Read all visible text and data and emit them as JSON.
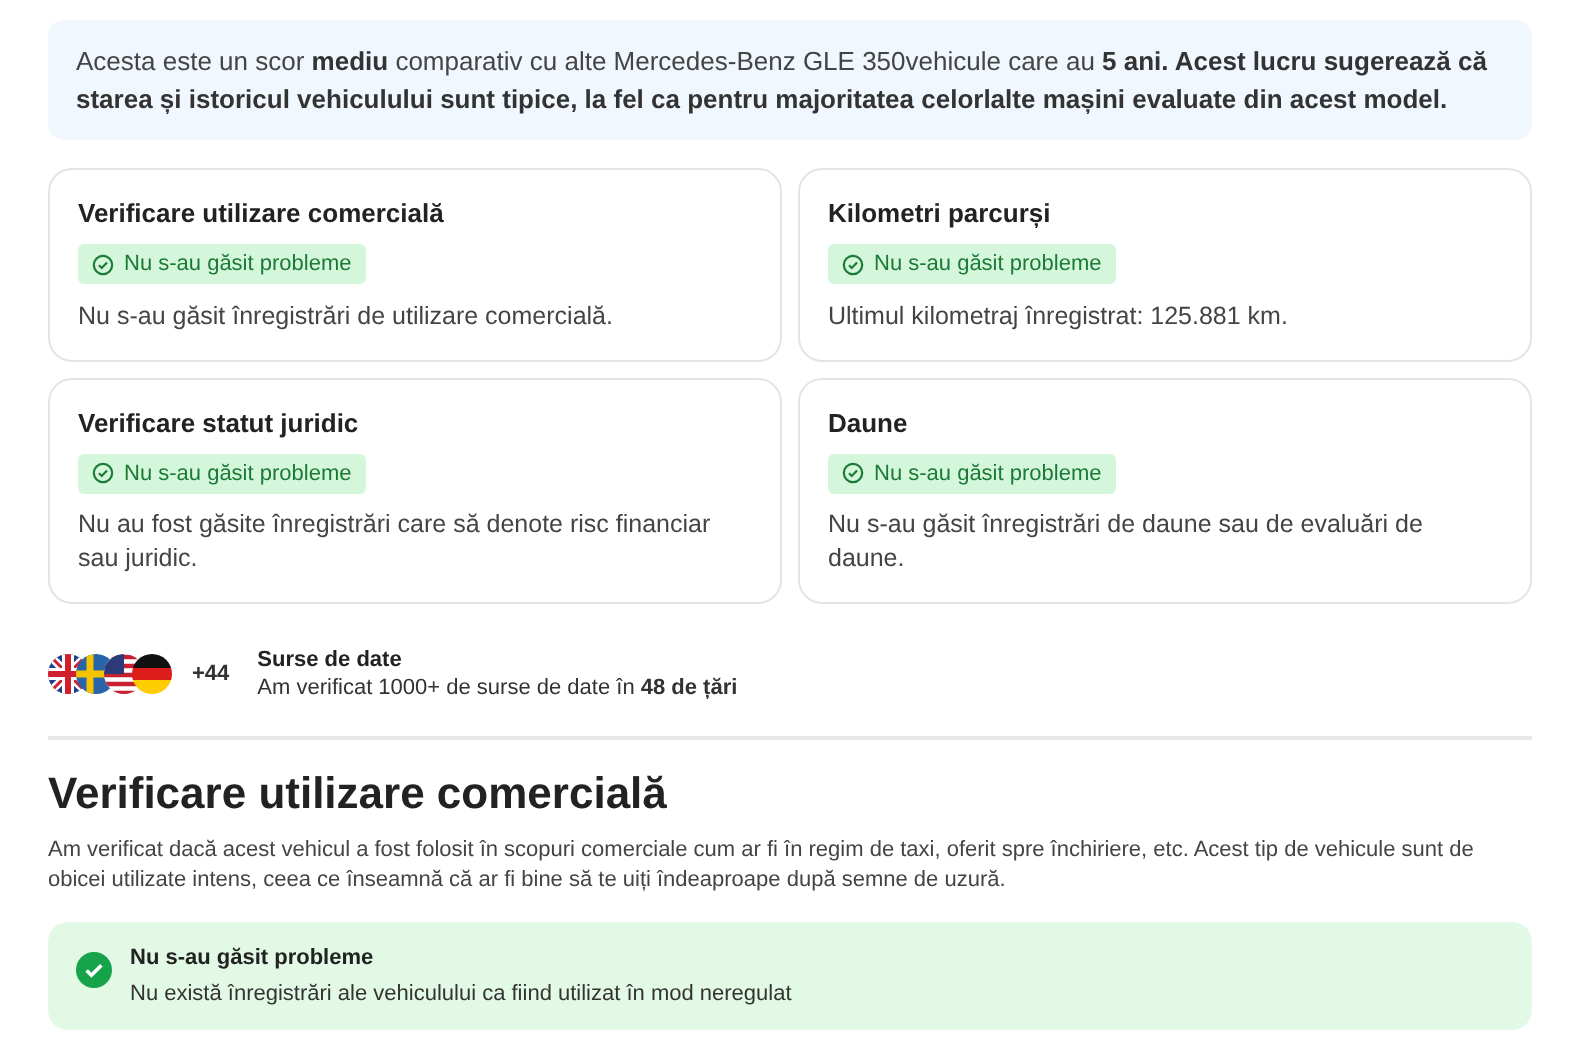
{
  "summary": {
    "text": "Acesta este un scor **mediu** comparativ cu alte Mercedes-Benz GLE 350vehicule care au **5 ani. Acest lucru sugerează că starea și istoricul vehiculului sunt tipice, la fel ca pentru majoritatea celorlalte mașini evaluate din acest model.**"
  },
  "cards": [
    {
      "title": "Verificare utilizare comercială",
      "badge": {
        "kind": "ok",
        "label": "Nu s-au găsit probleme"
      },
      "description": "Nu s-au găsit înregistrări de utilizare comercială."
    },
    {
      "title": "Kilometri parcurși",
      "badge": {
        "kind": "ok",
        "label": "Nu s-au găsit probleme"
      },
      "description": "Ultimul kilometraj înregistrat: 125.881 km."
    },
    {
      "title": "Verificare statut juridic",
      "badge": {
        "kind": "ok",
        "label": "Nu s-au găsit probleme"
      },
      "description": "Nu au fost găsite înregistrări care să denote risc financiar sau juridic."
    },
    {
      "title": "Daune",
      "badge": {
        "kind": "ok",
        "label": "Nu s-au găsit probleme"
      },
      "description": "Nu s-au găsit înregistrări de daune sau de evaluări de daune."
    }
  ],
  "sources": {
    "more_count": "+44",
    "title": "Surse de date",
    "text": "Am verificat 1000+ de surse de date în **48 de țări**"
  },
  "section": {
    "heading": "Verificare utilizare comercială",
    "text": "Am verificat dacă acest vehicul a fost folosit în scopuri comerciale cum ar fi în regim de taxi, oferit spre închiriere, etc. Acest tip de vehicule sunt de obicei utilizate intens, ceea ce înseamnă că ar fi bine să te uiți îndeaproape după semne de uzură.",
    "result": {
      "kind": "ok",
      "title": "Nu s-au găsit probleme",
      "text": "Nu există înregistrări ale vehiculului ca fiind utilizat în mod neregulat"
    }
  }
}
